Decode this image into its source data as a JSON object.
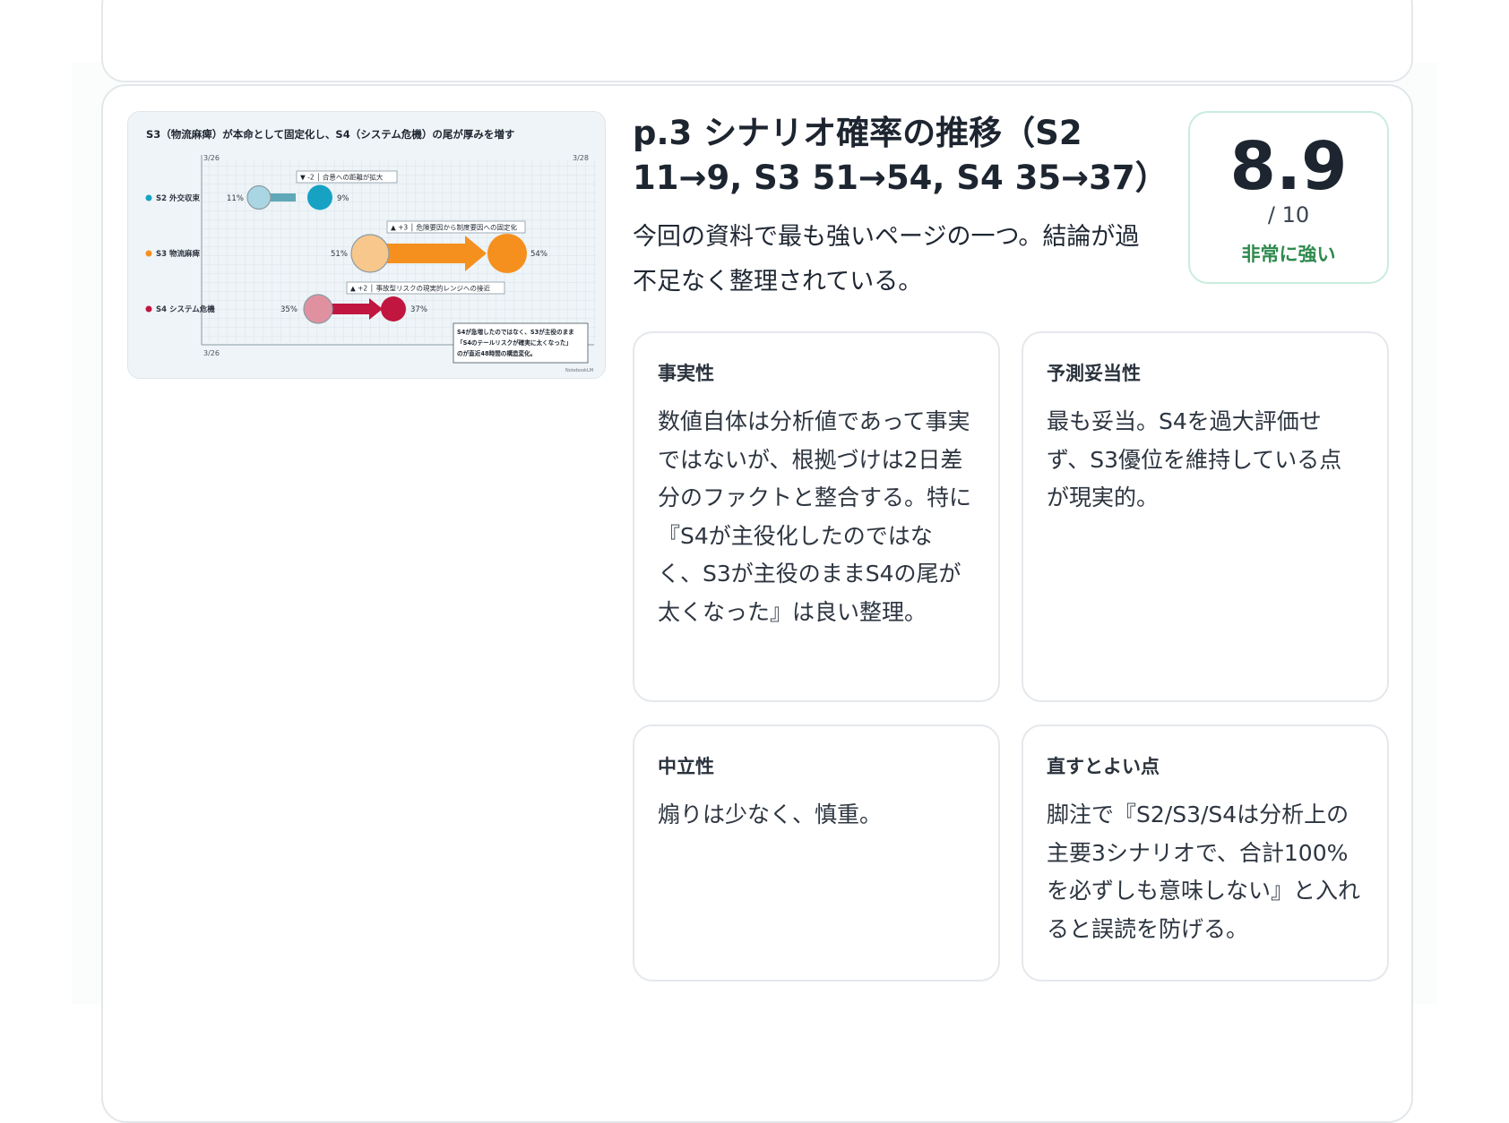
{
  "thumbnail": {
    "title": "S3（物流麻痺）が本命として固定化し、S4（システム危機）の尾が厚みを増す",
    "date_left_top": "3/26",
    "date_right_top": "3/28",
    "date_left_bottom": "3/26",
    "rows": [
      {
        "label": "S2 外交収束",
        "from": "11%",
        "to": "9%",
        "note": "▼ -2 │ 合意への距離が拡大",
        "color": "#17a2c4",
        "light": "#a9d6e2"
      },
      {
        "label": "S3 物流麻痺",
        "from": "51%",
        "to": "54%",
        "note": "▲ +3 │ 危険要因から制度要因への固定化",
        "color": "#f5901e",
        "light": "#f8c78c"
      },
      {
        "label": "S4 システム危機",
        "from": "35%",
        "to": "37%",
        "note": "▲ +2 │ 事故型リスクの現実的レンジへの接近",
        "color": "#c0163f",
        "light": "#e0919f"
      }
    ],
    "callout_lines": [
      "S4が急増したのではなく、S3が主役のまま",
      "「S4のテールリスクが確実に太くなった」",
      "のが直近48時間の構造変化。"
    ],
    "watermark": "NotebookLM"
  },
  "heading": "p.3 シナリオ確率の推移（S2 11→9, S3 51→54, S4 35→37）",
  "summary": "今回の資料で最も強いページの一つ。結論が過不足なく整理されている。",
  "score": {
    "value": "8.9",
    "scale": "/ 10",
    "label": "非常に強い"
  },
  "panels": [
    {
      "title": "事実性",
      "body": "数値自体は分析値であって事実ではないが、根拠づけは2日差分のファクトと整合する。特に『S4が主役化したのではなく、S3が主役のままS4の尾が太くなった』は良い整理。"
    },
    {
      "title": "予測妥当性",
      "body": "最も妥当。S4を過大評価せず、S3優位を維持している点が現実的。"
    },
    {
      "title": "中立性",
      "body": "煽りは少なく、慎重。"
    },
    {
      "title": "直すとよい点",
      "body": "脚注で『S2/S3/S4は分析上の主要3シナリオで、合計100%を必ずしも意味しない』と入れると誤読を防げる。"
    }
  ]
}
